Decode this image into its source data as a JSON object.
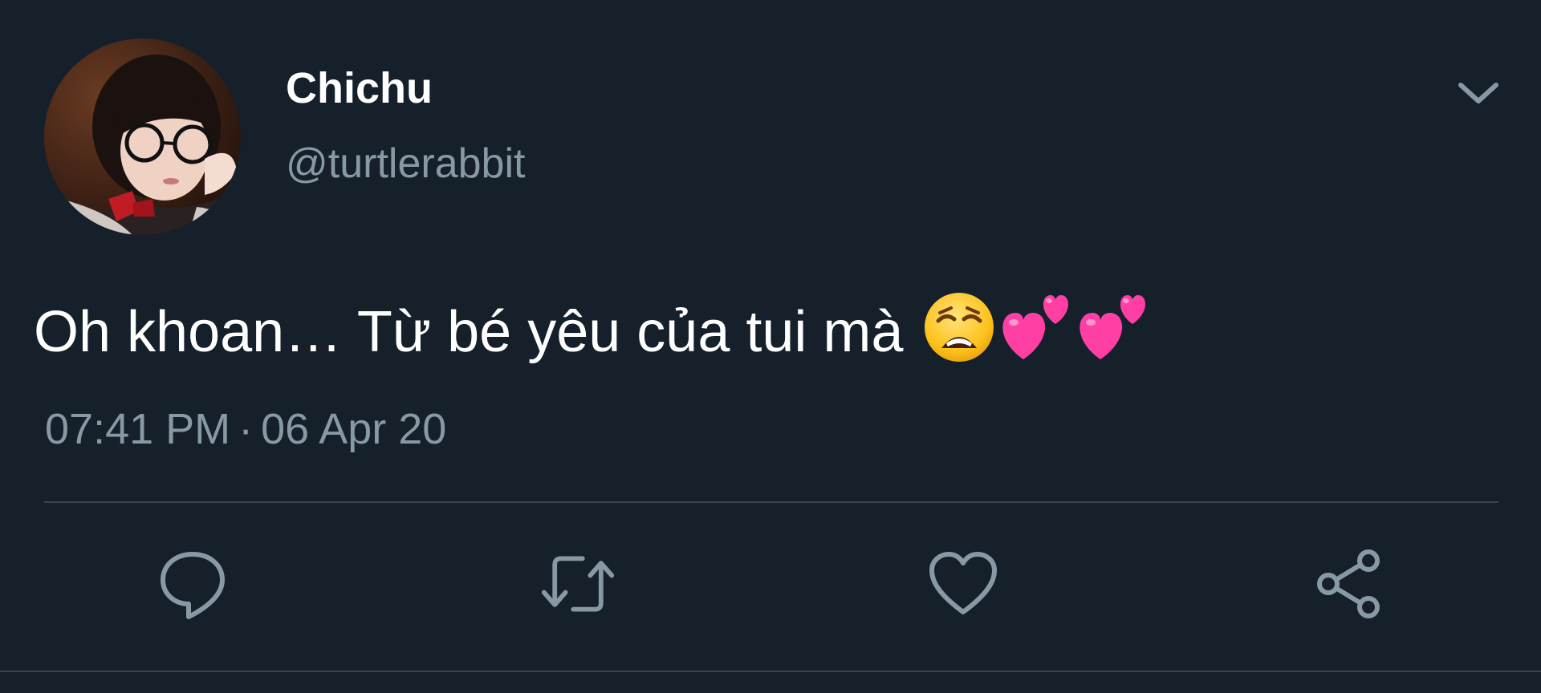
{
  "tweet": {
    "display_name": "Chichu",
    "handle": "@turtlerabbit",
    "text": "Oh khoan… Từ bé yêu của tui mà",
    "emojis": [
      "weary-face",
      "two-hearts",
      "two-hearts"
    ],
    "time": "07:41 PM",
    "separator": "·",
    "date": "06 Apr 20"
  },
  "icons": {
    "menu": "chevron-down-icon",
    "reply": "reply-icon",
    "retweet": "retweet-icon",
    "like": "heart-icon",
    "share": "share-icon"
  },
  "colors": {
    "background": "#15202b",
    "secondary_text": "#8899a6",
    "divider": "#38444d",
    "heart_emoji": "#ff3fa4"
  }
}
